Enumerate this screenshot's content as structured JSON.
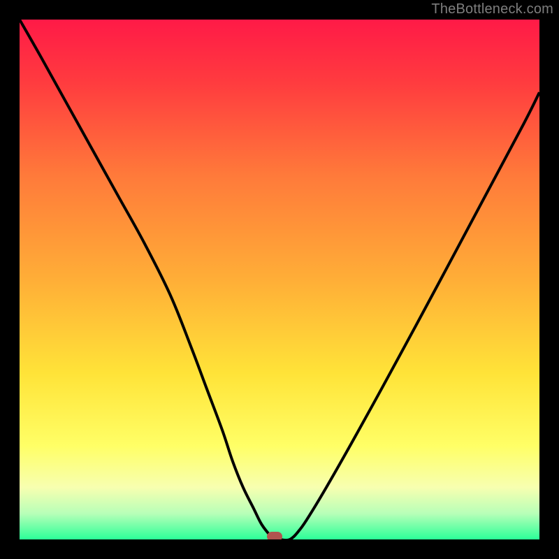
{
  "watermark": "TheBottleneck.com",
  "colors": {
    "frame": "#000000",
    "watermark": "#7e7e7e",
    "curve_stroke": "#000000",
    "marker": "#b1544f",
    "gradient_stops": [
      {
        "offset": "0%",
        "color": "#ff1a47"
      },
      {
        "offset": "12%",
        "color": "#ff3b3f"
      },
      {
        "offset": "30%",
        "color": "#ff7a3a"
      },
      {
        "offset": "50%",
        "color": "#ffae37"
      },
      {
        "offset": "68%",
        "color": "#ffe338"
      },
      {
        "offset": "82%",
        "color": "#ffff66"
      },
      {
        "offset": "90%",
        "color": "#f7ffb0"
      },
      {
        "offset": "95%",
        "color": "#b8ffb8"
      },
      {
        "offset": "100%",
        "color": "#2bff98"
      }
    ]
  },
  "chart_data": {
    "type": "line",
    "title": "",
    "xlabel": "",
    "ylabel": "",
    "xlim": [
      0,
      100
    ],
    "ylim": [
      0,
      100
    ],
    "grid": false,
    "legend": false,
    "x": [
      0,
      4,
      9,
      14,
      19,
      24,
      29,
      33,
      36,
      39,
      41,
      43,
      45,
      46.5,
      48,
      49,
      50,
      52,
      54,
      56,
      59,
      63,
      68,
      74,
      81,
      89,
      97,
      100
    ],
    "values": [
      100,
      93,
      84,
      75,
      66,
      57,
      47,
      37,
      29,
      21,
      15,
      10,
      6,
      3,
      1,
      0,
      0,
      0,
      2,
      5,
      10,
      17,
      26,
      37,
      50,
      65,
      80,
      86
    ],
    "marker": {
      "x": 49,
      "y": 0
    },
    "annotations": []
  }
}
